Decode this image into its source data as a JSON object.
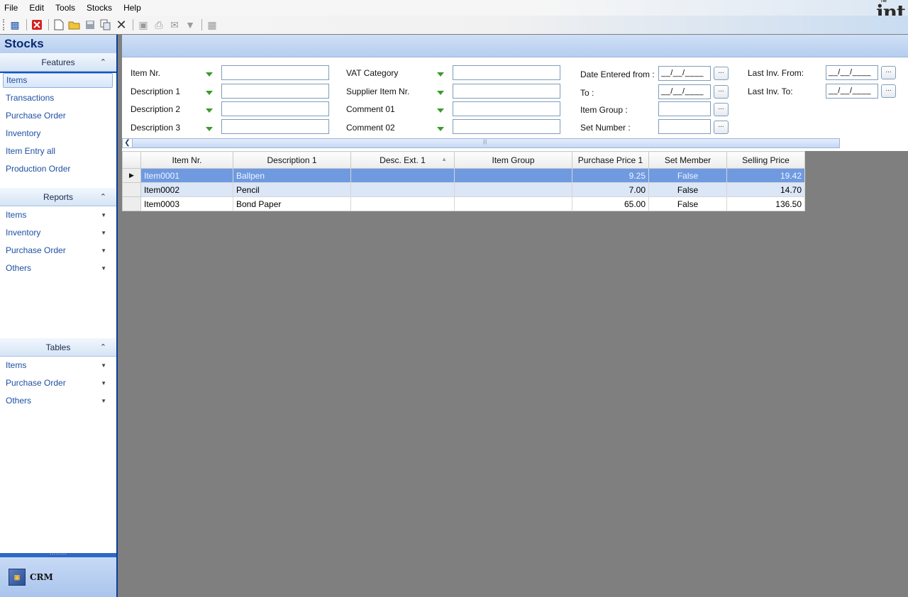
{
  "menu": [
    "File",
    "Edit",
    "Tools",
    "Stocks",
    "Help"
  ],
  "logo": "int",
  "logo_tm": "TM",
  "sidebar": {
    "title": "Stocks",
    "features_header": "Features",
    "features": [
      "Items",
      "Transactions",
      "Purchase Order",
      "Inventory",
      "Item Entry all",
      "Production Order"
    ],
    "reports_header": "Reports",
    "reports": [
      "Items",
      "Inventory",
      "Purchase Order",
      "Others"
    ],
    "tables_header": "Tables",
    "tables": [
      "Items",
      "Purchase Order",
      "Others"
    ],
    "bottom_label": "CRM"
  },
  "filters": {
    "item_nr": "Item Nr.",
    "desc1": "Description 1",
    "desc2": "Description 2",
    "desc3": "Description 3",
    "vat": "VAT Category",
    "supplier_item": "Supplier Item Nr.",
    "comment01": "Comment 01",
    "comment02": "Comment 02",
    "date_from": "Date Entered from :",
    "date_to": "To :",
    "item_group": "Item Group :",
    "set_number": "Set Number :",
    "last_inv_from": "Last Inv. From:",
    "last_inv_to": "Last Inv. To:",
    "date_placeholder": "__/__/____",
    "ellipsis": "..."
  },
  "grid": {
    "columns": [
      "Item Nr.",
      "Description 1",
      "Desc. Ext. 1",
      "Item Group",
      "Purchase Price 1",
      "Set Member",
      "Selling Price"
    ],
    "rows": [
      {
        "item_nr": "Item0001",
        "desc1": "Ballpen",
        "desc_ext": "",
        "group": "",
        "price1": "9.25",
        "set_member": "False",
        "selling": "19.42"
      },
      {
        "item_nr": "Item0002",
        "desc1": "Pencil",
        "desc_ext": "",
        "group": "",
        "price1": "7.00",
        "set_member": "False",
        "selling": "14.70"
      },
      {
        "item_nr": "Item0003",
        "desc1": "Bond Paper",
        "desc_ext": "",
        "group": "",
        "price1": "65.00",
        "set_member": "False",
        "selling": "136.50"
      }
    ]
  },
  "colors": {
    "sidebar_blue": "#0f54c0",
    "selected_row": "#6f9ae0",
    "filter_arrow": "#3d9a2c"
  }
}
